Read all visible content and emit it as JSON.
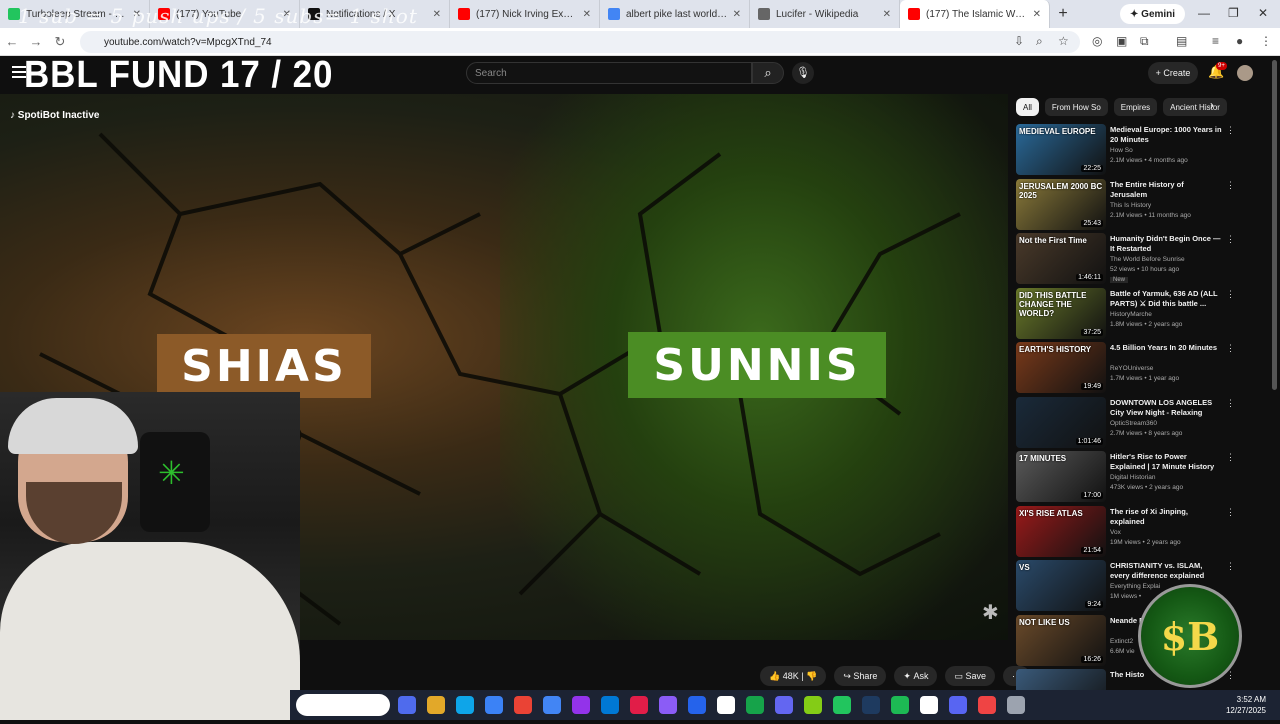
{
  "browser": {
    "tabs": [
      {
        "title": "Turboleep Stream - Watch",
        "color": "#22c55e"
      },
      {
        "title": "(177) YouTube",
        "color": "#ff0000"
      },
      {
        "title": "Notifications / X",
        "color": "#111111"
      },
      {
        "title": "(177) Nick Irving Explains Ho",
        "color": "#ff0000"
      },
      {
        "title": "albert pike last world war - G",
        "color": "#4285f4"
      },
      {
        "title": "Lucifer - Wikipedia",
        "color": "#666666"
      },
      {
        "title": "(177) The Islamic World:",
        "color": "#ff0000"
      }
    ],
    "gemini_label": "Gemini",
    "url": "youtube.com/watch?v=MpcgXTnd_74"
  },
  "overlay": {
    "stream_goal": "1 sub = 5 push ups / 5 subs= 1 shot",
    "fund": "BBL FUND  17 / 20",
    "spotibot": "SpotiBot Inactive"
  },
  "youtube": {
    "search_placeholder": "Search",
    "create_label": "+ Create",
    "notif_count": "9+",
    "video": {
      "label_left": "SHIAS",
      "label_right": "SUNNIS"
    },
    "actions": {
      "likes": "48K",
      "share": "Share",
      "ask": "Ask",
      "save": "Save",
      "more": "⋯"
    },
    "chips": [
      "All",
      "From How So",
      "Empires",
      "Ancient Histor"
    ],
    "recommendations": [
      {
        "thumb_text": "MEDIEVAL EUROPE",
        "duration": "22:25",
        "title": "Medieval Europe: 1000 Years in 20 Minutes",
        "channel": "How So",
        "meta": "2.1M views • 4 months ago",
        "thumb_color": "#2a6a9a"
      },
      {
        "thumb_text": "JERUSALEM 2000 BC 2025",
        "duration": "25:43",
        "title": "The Entire History of Jerusalem",
        "channel": "This Is History",
        "meta": "2.1M views • 11 months ago",
        "thumb_color": "#8a7a3a"
      },
      {
        "thumb_text": "Not the First Time",
        "duration": "1:46:11",
        "title": "Humanity Didn't Begin Once — It Restarted",
        "channel": "The World Before Sunrise",
        "meta": "52 views • 10 hours ago",
        "badge": "New",
        "thumb_color": "#4a3a2a"
      },
      {
        "thumb_text": "DID THIS BATTLE CHANGE THE WORLD?",
        "duration": "37:25",
        "title": "Battle of Yarmuk, 636 AD (ALL PARTS) ⚔ Did this battle ...",
        "channel": "HistoryMarche",
        "meta": "1.8M views • 2 years ago",
        "thumb_color": "#6a7a2a"
      },
      {
        "thumb_text": "EARTH'S HISTORY",
        "duration": "19:49",
        "title": "4.5 Billion Years In 20 Minutes",
        "channel": "ReYOUniverse",
        "meta": "1.7M views • 1 year ago",
        "thumb_color": "#7a3a1a"
      },
      {
        "thumb_text": "",
        "duration": "1:01:46",
        "title": "DOWNTOWN LOS ANGELES City View Night - Relaxing Video ...",
        "channel": "OpticStream360",
        "meta": "2.7M views • 8 years ago",
        "thumb_color": "#1a2a3a"
      },
      {
        "thumb_text": "17 MINUTES",
        "duration": "17:00",
        "title": "Hitler's Rise to Power Explained | 17 Minute History Lesson",
        "channel": "Digital Historian",
        "meta": "473K views • 2 years ago",
        "thumb_color": "#5a5a5a"
      },
      {
        "thumb_text": "XI'S RISE ATLAS",
        "duration": "21:54",
        "title": "The rise of Xi Jinping, explained",
        "channel": "Vox",
        "meta": "19M views • 2 years ago",
        "thumb_color": "#9a1a1a"
      },
      {
        "thumb_text": "VS",
        "duration": "9:24",
        "title": "CHRISTIANITY vs. ISLAM, every difference explained",
        "channel": "Everything Explai",
        "meta": "1M views •",
        "thumb_color": "#2a4a6a"
      },
      {
        "thumb_text": "NOT LIKE US",
        "duration": "16:26",
        "title": "Neande Freaks",
        "channel": "Extinct2",
        "meta": "6.6M vie",
        "thumb_color": "#6a4a2a"
      },
      {
        "thumb_text": "",
        "duration": "",
        "title": "The Histo",
        "channel": "",
        "meta": "",
        "thumb_color": "#3a5a7a"
      }
    ]
  },
  "taskbar": {
    "time": "3:52 AM",
    "date": "12/27/2025",
    "icon_colors": [
      "#4f6bed",
      "#e2a829",
      "#0ea5e9",
      "#3b82f6",
      "#ea4335",
      "#4285f4",
      "#9333ea",
      "#0078d4",
      "#e11d48",
      "#8b5cf6",
      "#2563eb",
      "#ffffff",
      "#16a34a",
      "#6366f1",
      "#84cc16",
      "#22c55e",
      "#1e3a5f",
      "#1db954",
      "#ffffff",
      "#5865f2",
      "#ef4444",
      "#9ca3af"
    ]
  },
  "stream_logo": "$B"
}
